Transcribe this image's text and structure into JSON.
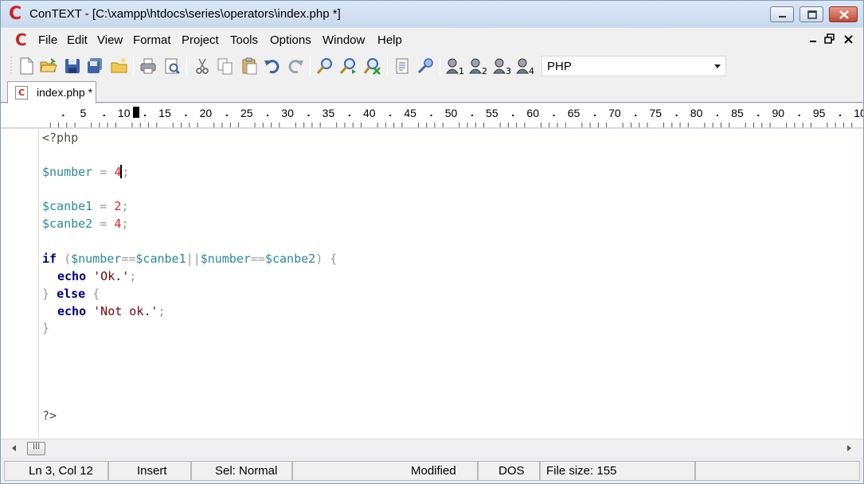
{
  "window": {
    "title": "ConTEXT - [C:\\xampp\\htdocs\\series\\operators\\index.php *]",
    "logo_letter": "C"
  },
  "menu": {
    "items": [
      "File",
      "Edit",
      "View",
      "Format",
      "Project",
      "Tools",
      "Options",
      "Window",
      "Help"
    ]
  },
  "toolbar": {
    "language": "PHP"
  },
  "tab": {
    "label": "index.php *"
  },
  "ruler": {
    "labels": [
      "5",
      "10",
      "15",
      "20",
      "25",
      "30",
      "35",
      "40",
      "45",
      "50",
      "55",
      "60",
      "65",
      "70",
      "75",
      "80",
      "85",
      "90",
      "95",
      "10"
    ]
  },
  "code": {
    "l1_open": "<?php",
    "l3_var": "$number",
    "l3_op": " = ",
    "l3_num": "4",
    "l3_semi": ";",
    "l5_var": "$canbe1",
    "l5_op": " = ",
    "l5_num": "2",
    "l5_semi": ";",
    "l6_var": "$canbe2",
    "l6_op": " = ",
    "l6_num": "4",
    "l6_semi": ";",
    "l8_if": "if",
    "l8_p1": " (",
    "l8_v1": "$number",
    "l8_eq1": "==",
    "l8_v2": "$canbe1",
    "l8_or": "||",
    "l8_v3": "$number",
    "l8_eq2": "==",
    "l8_v4": "$canbe2",
    "l8_p2": ") {",
    "l9_echo": "echo",
    "l9_str": "'Ok.'",
    "l9_semi": ";",
    "l10_close": "} ",
    "l10_else": "else",
    "l10_open": " {",
    "l11_echo": "echo",
    "l11_str": "'Not ok.'",
    "l11_semi": ";",
    "l12_close": "}",
    "l17_close": "?>"
  },
  "scrollbar": {
    "thumb_grip": "III"
  },
  "status": {
    "position": "Ln 3, Col 12",
    "mode": "Insert",
    "selection": "Sel: Normal",
    "modified": "Modified",
    "line_endings": "DOS",
    "file_size": "File size: 155"
  },
  "colors": {
    "variable": "#2a8a95",
    "number": "#e02020",
    "keyword": "#000080",
    "string": "#7a0000",
    "logo": "#cc2222"
  }
}
